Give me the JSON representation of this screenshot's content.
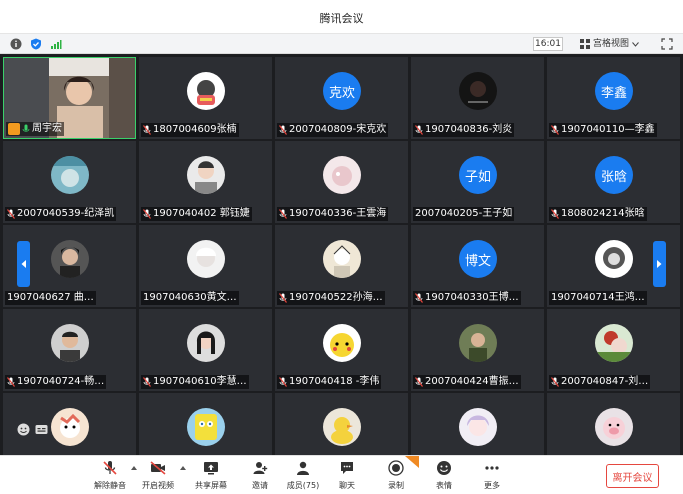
{
  "window": {
    "title": "腾讯会议"
  },
  "statusbar": {
    "time": "16:01",
    "view_label": "宫格视图"
  },
  "colors": {
    "accent": "#1a7cf0",
    "leave": "#e5473f",
    "signal": "#2fb344"
  },
  "participants": [
    {
      "name": "周宇宏",
      "avatar": "video",
      "self": true
    },
    {
      "name": "1807004609张楠",
      "avatar": "cat",
      "muted": true
    },
    {
      "name": "2007040809-宋克欢",
      "avatar_text": "克欢",
      "muted": true
    },
    {
      "name": "1907040836-刘炎",
      "avatar": "dark",
      "muted": true
    },
    {
      "name": "1907040110—李鑫",
      "avatar_text": "李鑫",
      "muted": true
    },
    {
      "name": "2007040539-纪泽凯",
      "avatar": "teal",
      "muted": true
    },
    {
      "name": "1907040402 郭钰婕",
      "avatar": "person",
      "muted": true
    },
    {
      "name": "1907040336-王雲海",
      "avatar": "pink",
      "muted": true
    },
    {
      "name": "2007040205-王子如",
      "avatar_text": "子如",
      "muted": false
    },
    {
      "name": "1808024214张晗",
      "avatar_text": "张晗",
      "muted": true
    },
    {
      "name": "1907040627  曲…",
      "avatar": "darkhair",
      "muted": false
    },
    {
      "name": "1907040630黄文…",
      "avatar": "white",
      "muted": false
    },
    {
      "name": "1907040522孙海…",
      "avatar": "sketch",
      "muted": true
    },
    {
      "name": "1907040330王博…",
      "avatar_text": "博文",
      "muted": true
    },
    {
      "name": "1907040714王鸿…",
      "avatar": "hood",
      "muted": false
    },
    {
      "name": "1907040724-畅…",
      "avatar": "man",
      "muted": true
    },
    {
      "name": "1907040610李慧…",
      "avatar": "girl",
      "muted": true
    },
    {
      "name": "1907040418 -李伟",
      "avatar": "pikachu",
      "muted": true
    },
    {
      "name": "2007040424曹振…",
      "avatar": "outdoor",
      "muted": true
    },
    {
      "name": "2007040847-刘…",
      "avatar": "flower",
      "muted": true
    },
    {
      "name": "",
      "avatar": "cartoon",
      "muted": false
    },
    {
      "name": "",
      "avatar": "sponge",
      "muted": false
    },
    {
      "name": "",
      "avatar": "duck",
      "muted": false
    },
    {
      "name": "",
      "avatar": "anime",
      "muted": false
    },
    {
      "name": "",
      "avatar": "pig",
      "muted": false
    }
  ],
  "toolbar": {
    "unmute": "解除静音",
    "video": "开启视频",
    "share": "共享屏幕",
    "invite": "邀请",
    "members": "成员(75)",
    "chat": "聊天",
    "record": "录制",
    "emoji": "表情",
    "more": "更多",
    "leave": "离开会议"
  }
}
